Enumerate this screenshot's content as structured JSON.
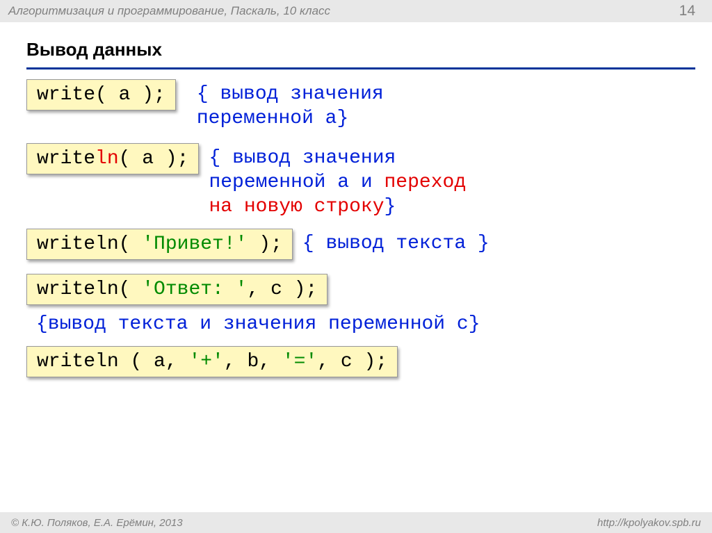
{
  "header": {
    "title": "Алгоритмизация и программирование, Паскаль, 10 класс",
    "page": "14"
  },
  "section_title": "Вывод данных",
  "row1": {
    "code_write": "write",
    "code_rest": "( a );",
    "comment_open": "{ ",
    "comment_l1": "вывод значения",
    "comment_l2_pad": "  ",
    "comment_l2": "переменной a",
    "comment_close": "}"
  },
  "row2": {
    "code_write": "write",
    "code_ln": "ln",
    "code_rest": "( a );",
    "comment_open": "{ ",
    "comment_l1": "вывод значения",
    "comment_l2_pad": "  ",
    "comment_l2": "переменной a и ",
    "comment_l2_red": "переход",
    "comment_l3_pad": "  ",
    "comment_l3_red": "на новую строку",
    "comment_close": "}"
  },
  "row3": {
    "code_pre": "writeln( ",
    "code_str": "'Привет!'",
    "code_post": " );",
    "comment": "{ вывод текста }"
  },
  "row4": {
    "code_pre": "writeln( ",
    "code_str": "'Ответ: '",
    "code_post": ", c );"
  },
  "row4_comment": "{вывод текста и значения переменной c}",
  "row5": {
    "p1": "writeln ( a, ",
    "s1": "'+'",
    "p2": ", b, ",
    "s2": "'='",
    "p3": ", c );"
  },
  "footer": {
    "copyright": "© К.Ю. Поляков, Е.А. Ерёмин, 2013",
    "url": "http://kpolyakov.spb.ru"
  }
}
